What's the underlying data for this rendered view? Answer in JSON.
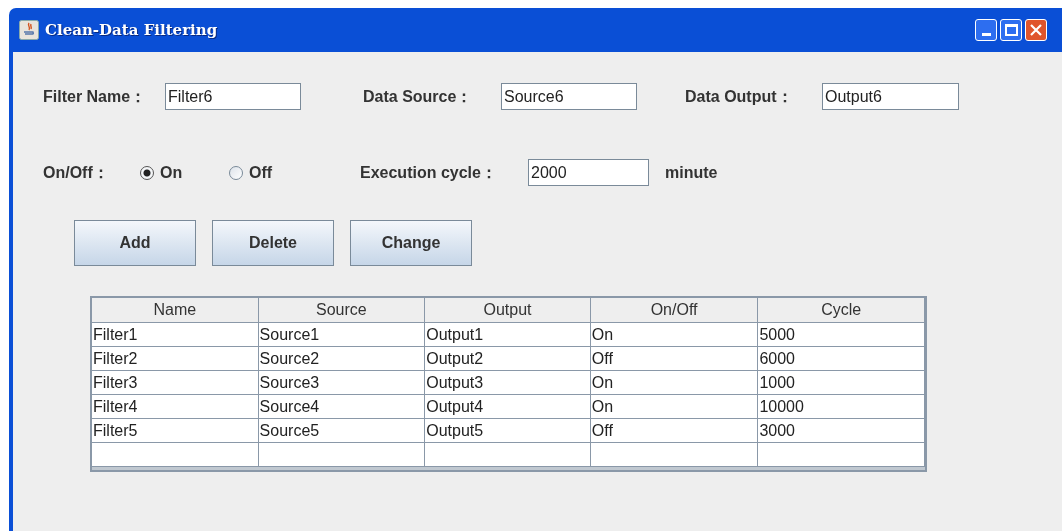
{
  "window": {
    "title": "Clean-Data Filtering"
  },
  "form": {
    "filter_name": {
      "label": "Filter Name：",
      "value": "Filter6"
    },
    "data_source": {
      "label": "Data Source：",
      "value": "Source6"
    },
    "data_output": {
      "label": "Data Output：",
      "value": "Output6"
    },
    "on_off": {
      "label": "On/Off：",
      "options": [
        {
          "label": "On",
          "selected": true
        },
        {
          "label": "Off",
          "selected": false
        }
      ]
    },
    "execution_cycle": {
      "label": "Execution cycle：",
      "value": "2000",
      "unit": "minute"
    }
  },
  "buttons": [
    "Add",
    "Delete",
    "Change"
  ],
  "table": {
    "columns": [
      "Name",
      "Source",
      "Output",
      "On/Off",
      "Cycle"
    ],
    "rows": [
      [
        "Filter1",
        "Source1",
        "Output1",
        "On",
        "5000"
      ],
      [
        "Filter2",
        "Source2",
        "Output2",
        "Off",
        "6000"
      ],
      [
        "Filter3",
        "Source3",
        "Output3",
        "On",
        "1000"
      ],
      [
        "Filter4",
        "Source4",
        "Output4",
        "On",
        "10000"
      ],
      [
        "Filter5",
        "Source5",
        "Output5",
        "Off",
        "3000"
      ]
    ]
  }
}
